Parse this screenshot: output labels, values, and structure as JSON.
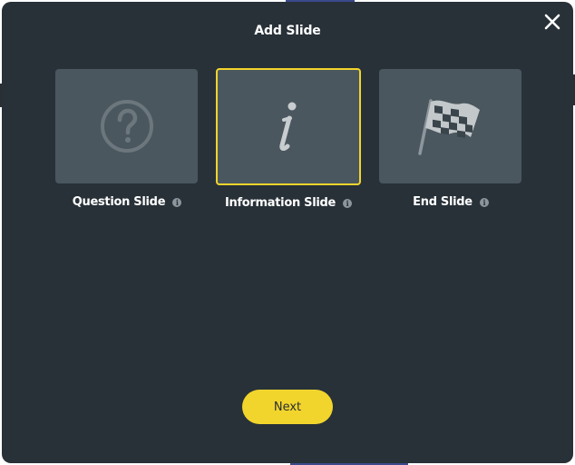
{
  "dialog": {
    "title": "Add Slide",
    "close_icon": "close-icon"
  },
  "slide_types": [
    {
      "label": "Question Slide",
      "icon": "question-circle-icon",
      "selected": false
    },
    {
      "label": "Information Slide",
      "icon": "info-italic-icon",
      "selected": true
    },
    {
      "label": "End Slide",
      "icon": "checkered-flag-icon",
      "selected": false
    }
  ],
  "info_glyph": "i",
  "footer": {
    "next_label": "Next"
  },
  "colors": {
    "modal_bg": "#283138",
    "card_bg": "#4b575f",
    "accent": "#f2d52c",
    "text": "#ffffff"
  }
}
